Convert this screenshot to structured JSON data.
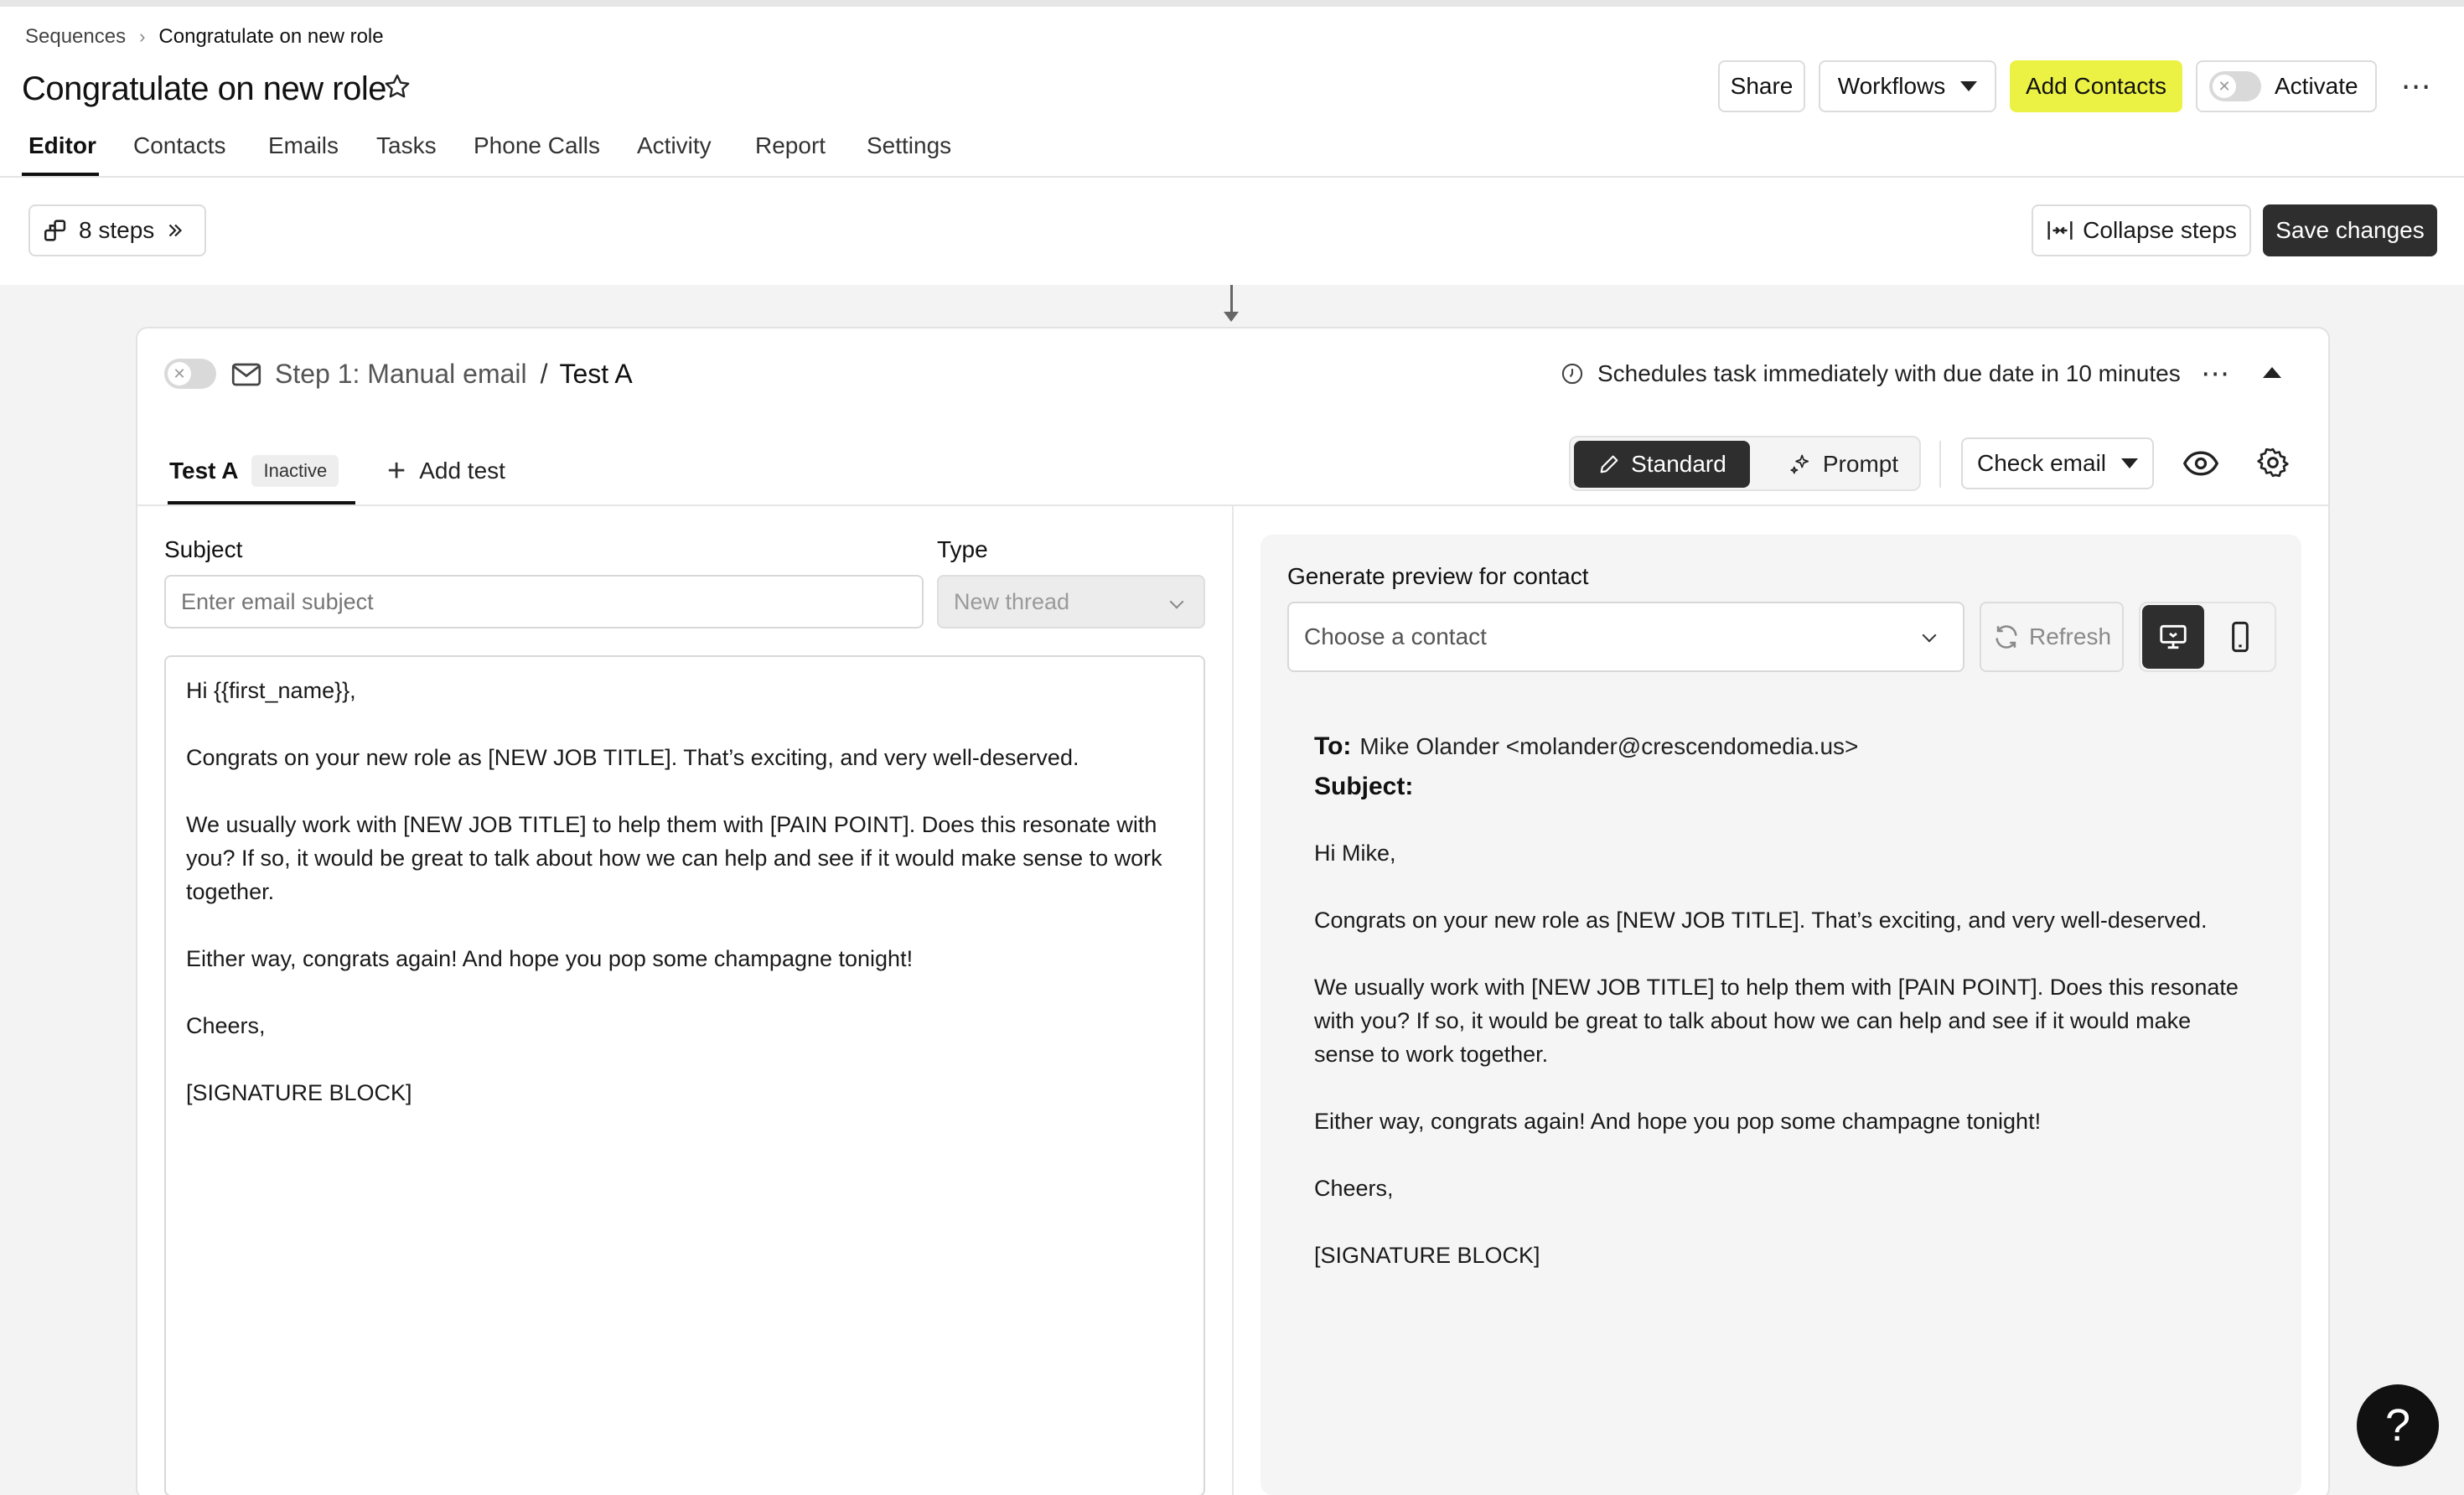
{
  "breadcrumb": {
    "root": "Sequences",
    "current": "Congratulate on new role"
  },
  "page": {
    "title": "Congratulate on new role"
  },
  "header_actions": {
    "share": "Share",
    "workflows": "Workflows",
    "add_contacts": "Add Contacts",
    "activate": "Activate",
    "activate_on": false,
    "more": "⋯"
  },
  "tabs": [
    {
      "label": "Editor",
      "active": true
    },
    {
      "label": "Contacts"
    },
    {
      "label": "Emails"
    },
    {
      "label": "Tasks"
    },
    {
      "label": "Phone Calls"
    },
    {
      "label": "Activity"
    },
    {
      "label": "Report"
    },
    {
      "label": "Settings"
    }
  ],
  "toolbar": {
    "steps": "8 steps",
    "collapse": "Collapse steps",
    "save": "Save changes"
  },
  "step": {
    "enabled": false,
    "title": "Step 1: Manual email",
    "separator": "/",
    "test_name": "Test A",
    "schedule": "Schedules task immediately with due date in 10 minutes",
    "more": "⋯",
    "test_tab": "Test A",
    "test_status": "Inactive",
    "add_test": "Add test",
    "mode_standard": "Standard",
    "mode_prompt": "Prompt",
    "mode_selected": "Standard",
    "check_email": "Check email"
  },
  "editor": {
    "subject_label": "Subject",
    "subject_placeholder": "Enter email subject",
    "subject_value": "",
    "type_label": "Type",
    "type_value": "New thread",
    "body": [
      "Hi {{first_name}},",
      "Congrats on your new role as [NEW JOB TITLE]. That’s exciting, and very well-deserved.",
      "We usually work with [NEW JOB TITLE] to help them with [PAIN POINT]. Does this resonate with you? If so, it would be great to talk about how we can help and see if it would make sense to work together.",
      "Either way, congrats again! And hope you pop some champagne tonight!",
      "Cheers,",
      "[SIGNATURE BLOCK]"
    ]
  },
  "preview": {
    "label": "Generate preview for contact",
    "contact_placeholder": "Choose a contact",
    "refresh": "Refresh",
    "device_selected": "desktop",
    "to_label": "To:",
    "to_value": "Mike Olander <molander@crescendomedia.us>",
    "subject_label": "Subject:",
    "subject_value": "",
    "body": [
      "Hi Mike,",
      "Congrats on your new role as [NEW JOB TITLE]. That’s exciting, and very well-deserved.",
      "We usually work with [NEW JOB TITLE] to help them with [PAIN POINT]. Does this resonate with you? If so, it would be great to talk about how we can help and see if it would make sense to work together.",
      "Either way, congrats again! And hope you pop some champagne tonight!",
      "Cheers,",
      "[SIGNATURE BLOCK]"
    ]
  },
  "help": {
    "label": "?"
  },
  "colors": {
    "accent_yellow": "#ecf244",
    "dark_button": "#2e2e2e",
    "canvas_bg": "#f3f3f3"
  }
}
